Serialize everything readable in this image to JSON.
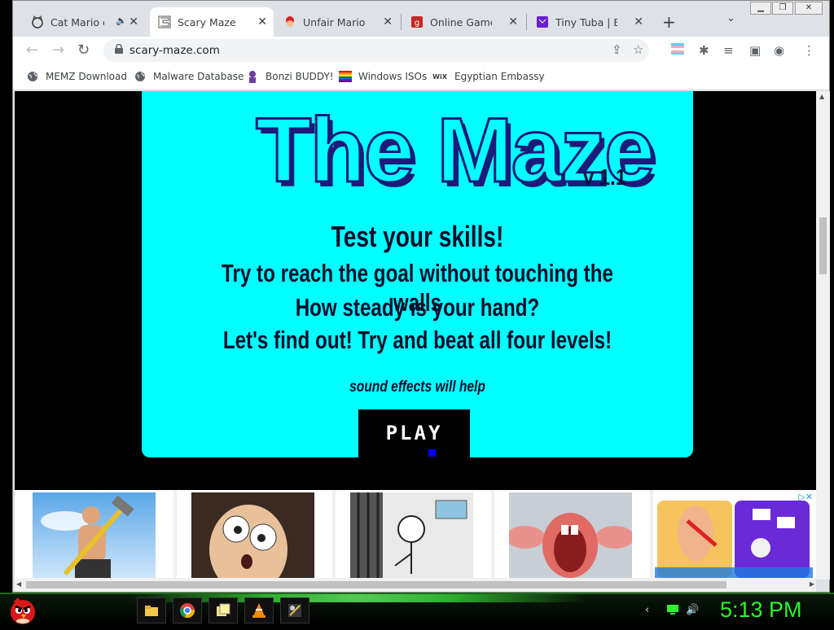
{
  "tabs": [
    {
      "title": "Cat Mario on",
      "icon": "cat-icon",
      "muted_icon": "speaker-icon"
    },
    {
      "title": "Scary Maze gam",
      "icon": "maze-icon",
      "active": true
    },
    {
      "title": "Unfair Mario",
      "icon": "mario-icon"
    },
    {
      "title": "Online Games fo",
      "icon": "game-logo-icon"
    },
    {
      "title": "Tiny Tuba | BORE",
      "icon": "purple-square-icon"
    }
  ],
  "toolbar": {
    "url": "scary-maze.com"
  },
  "bookmarks": [
    {
      "label": "MEMZ Download",
      "icon": "globe-icon"
    },
    {
      "label": "Malware Database",
      "icon": "globe-icon"
    },
    {
      "label": "Bonzi BUDDY!",
      "icon": "bonzi-icon"
    },
    {
      "label": "Windows ISOs",
      "icon": "rainbow-flag-icon"
    },
    {
      "label": "Egyptian Embassy",
      "icon": "wix-icon",
      "icon_text": "WiX"
    }
  ],
  "game": {
    "title": "The Maze",
    "version": "v 1.1",
    "line1": "Test your skills!",
    "line2": "Try to reach the goal without touching the walls",
    "line3": "How steady is your hand?",
    "line4": "Let's find out! Try and beat all four levels!",
    "sound_note": "sound effects will help",
    "play_label": "PLAY"
  },
  "taskbar": {
    "clock": "5:13 PM"
  },
  "colors": {
    "game_bg": "#00ffff",
    "title_outline": "#1b1b7a",
    "clock": "#2cf52c"
  }
}
